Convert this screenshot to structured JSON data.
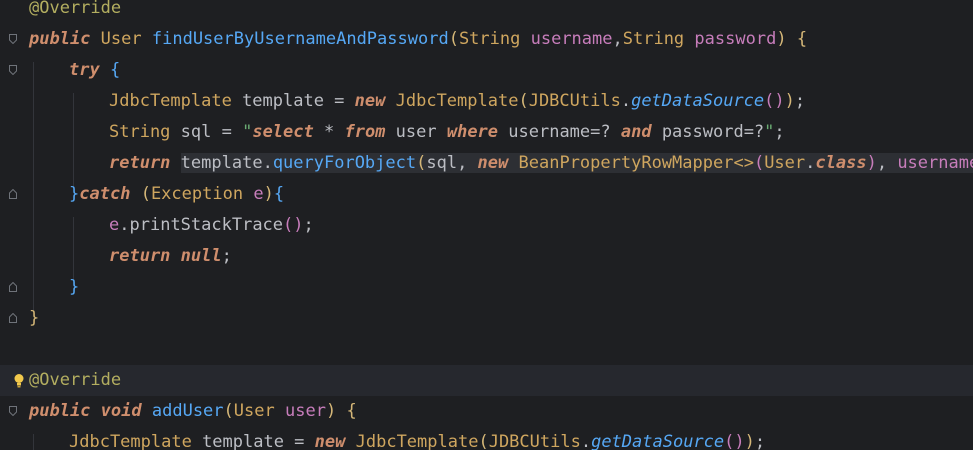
{
  "lines": [
    {
      "t": "@Override"
    },
    {
      "t": "public User findUserByUsernameAndPassword(String username,String password) {"
    },
    {
      "t": "try {"
    },
    {
      "t": "JdbcTemplate template = new JdbcTemplate(JDBCUtils.getDataSource());"
    },
    {
      "t": "String sql = \"select * from user where username=? and password=?\";"
    },
    {
      "t": "return template.queryForObject(sql, new BeanPropertyRowMapper<>(User.class), username,"
    },
    {
      "t": "}catch (Exception e){"
    },
    {
      "t": "e.printStackTrace();"
    },
    {
      "t": "return null;"
    },
    {
      "t": "}"
    },
    {
      "t": "}"
    },
    {
      "t": ""
    },
    {
      "t": "@Override"
    },
    {
      "t": "public void addUser(User user) {"
    },
    {
      "t": "JdbcTemplate template = new JdbcTemplate(JDBCUtils.getDataSource());"
    }
  ],
  "tokens": {
    "l0": [
      "@Override"
    ],
    "l1": [
      "public",
      " ",
      "User",
      " ",
      "findUserByUsernameAndPassword",
      "(",
      "String",
      " ",
      "username",
      ",",
      "String",
      " ",
      "password",
      ")",
      " ",
      "{"
    ],
    "l2": [
      "try",
      " ",
      "{"
    ],
    "l3": [
      "JdbcTemplate",
      " template = ",
      "new",
      " ",
      "JdbcTemplate",
      "(",
      "JDBCUtils",
      ".",
      "getDataSource",
      "(",
      ")",
      ")",
      ";"
    ],
    "l4": [
      "String",
      " sql = ",
      "\"",
      "select",
      " * ",
      "from",
      " user ",
      "where",
      " username=? ",
      "and",
      " password=?",
      "\"",
      ";"
    ],
    "l5": [
      "return",
      " ",
      "template",
      ".",
      "queryForObject",
      "(",
      "sql, ",
      "new",
      " ",
      "BeanPropertyRowMapper",
      "<>",
      "(",
      "User",
      ".",
      "class",
      ")",
      ", ",
      "username",
      ","
    ],
    "l6": [
      "}",
      "catch",
      " ",
      "(",
      "Exception",
      " ",
      "e",
      ")",
      "{"
    ],
    "l7": [
      "e",
      ".",
      "printStackTrace",
      "(",
      ")",
      ";"
    ],
    "l8": [
      "return",
      " ",
      "null",
      ";"
    ],
    "l9": [
      "}"
    ],
    "l10": [
      "}"
    ],
    "l12": [
      "@Override"
    ],
    "l13": [
      "public",
      " ",
      "void",
      " ",
      "addUser",
      "(",
      "User",
      " ",
      "user",
      ")",
      " ",
      "{"
    ],
    "l14": [
      "JdbcTemplate",
      " template = ",
      "new",
      " ",
      "JdbcTemplate",
      "(",
      "JDBCUtils",
      ".",
      "getDataSource",
      "(",
      ")",
      ")",
      ";"
    ]
  },
  "colors": {
    "background": "#1e1f22",
    "keyword": "#cf8e6d",
    "annotation": "#b3ae60",
    "function": "#56a8f5",
    "string": "#6aab73",
    "parameter": "#c77dbb",
    "type": "#cfa65f",
    "bulb": "#f2c94c"
  },
  "icons": {
    "fold": "fold-arrow-icon",
    "bulb": "lightbulb-icon"
  }
}
